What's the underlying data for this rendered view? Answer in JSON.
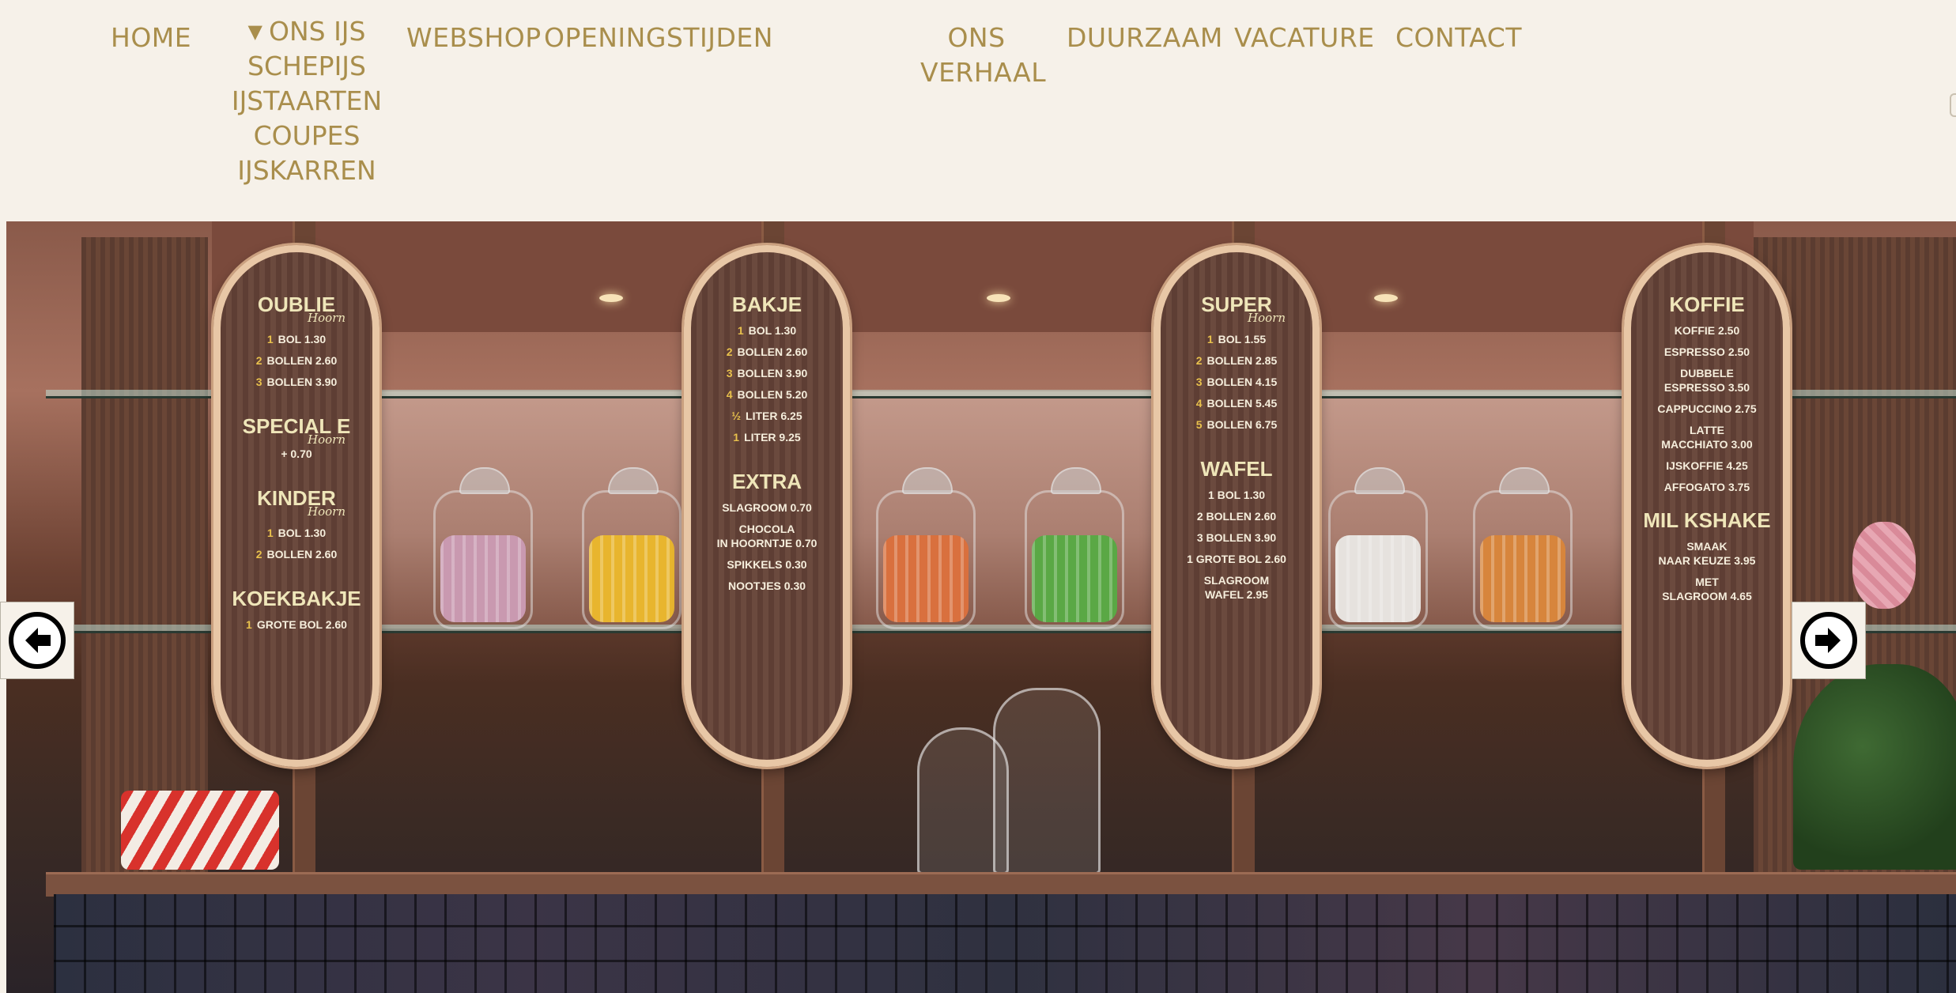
{
  "nav": {
    "home": "HOME",
    "ons_ijs": {
      "label": "ONS IJS",
      "submenu": [
        "SCHEPIJS",
        "IJSTAARTEN",
        "COUPES",
        "IJSKARREN"
      ]
    },
    "webshop": "WEBSHOP",
    "openingstijden": "OPENINGSTIJDEN",
    "ons_verhaal": "ONS VERHAAL",
    "duurzaam": "DUURZAAM",
    "vacature": "VACATURE",
    "contact": "CONTACT"
  },
  "colors": {
    "nav_text": "#a98e4c",
    "background": "#f6f1e9"
  },
  "slider": {
    "prev_icon": "arrow-left-icon",
    "next_icon": "arrow-right-icon"
  },
  "menu_boards": {
    "board1": {
      "oublie": "OUBLIE",
      "oublie_script": "Hoorn",
      "oublie_1": "BOL 1.30",
      "oublie_2": "BOLLEN 2.60",
      "oublie_3": "BOLLEN 3.90",
      "speciale": "SPECIAL E",
      "speciale_script": "Hoorn",
      "speciale_price": "+ 0.70",
      "kinder": "KINDER",
      "kinder_script": "Hoorn",
      "kinder_1": "BOL 1.30",
      "kinder_2": "BOLLEN 2.60",
      "koekbakje": "KOEKBAKJE",
      "koekbakje_1": "GROTE BOL 2.60"
    },
    "board2": {
      "bakje": "BAKJE",
      "bakje_1": "BOL 1.30",
      "bakje_2": "BOLLEN 2.60",
      "bakje_3": "BOLLEN 3.90",
      "bakje_4": "BOLLEN 5.20",
      "bakje_half": "LITER 6.25",
      "bakje_liter": "LITER 9.25",
      "extra": "EXTRA",
      "slagroom": "SLAGROOM 0.70",
      "chocola_1": "CHOCOLA",
      "chocola_2": "IN HOORNTJE 0.70",
      "spikkels": "SPIKKELS 0.30",
      "nootjes": "NOOTJES 0.30"
    },
    "board3": {
      "super": "SUPER",
      "super_script": "Hoorn",
      "super_1": "BOL 1.55",
      "super_2": "BOLLEN 2.85",
      "super_3": "BOLLEN 4.15",
      "super_4": "BOLLEN 5.45",
      "super_5": "BOLLEN 6.75",
      "wafel": "WAFEL",
      "wafel_1": "1 BOL 1.30",
      "wafel_2": "2 BOLLEN 2.60",
      "wafel_3": "3 BOLLEN 3.90",
      "wafel_grote": "1 GROTE BOL 2.60",
      "slagroom_wafel_1": "SLAGROOM",
      "slagroom_wafel_2": "WAFEL 2.95"
    },
    "board4": {
      "koffie": "KOFFIE",
      "koffie_1": "KOFFIE 2.50",
      "espresso": "ESPRESSO 2.50",
      "dubbele_1": "DUBBELE",
      "dubbele_2": "ESPRESSO 3.50",
      "cappuccino": "CAPPUCCINO 2.75",
      "latte_1": "LATTE",
      "latte_2": "MACCHIATO 3.00",
      "ijskoffie": "IJSKOFFIE 4.25",
      "affogato": "AFFOGATO 3.75",
      "milkshake": "MIL KSHAKE",
      "smaak_1": "SMAAK",
      "smaak_2": "NAAR KEUZE 3.95",
      "met_1": "MET",
      "met_2": "SLAGROOM 4.65"
    }
  }
}
